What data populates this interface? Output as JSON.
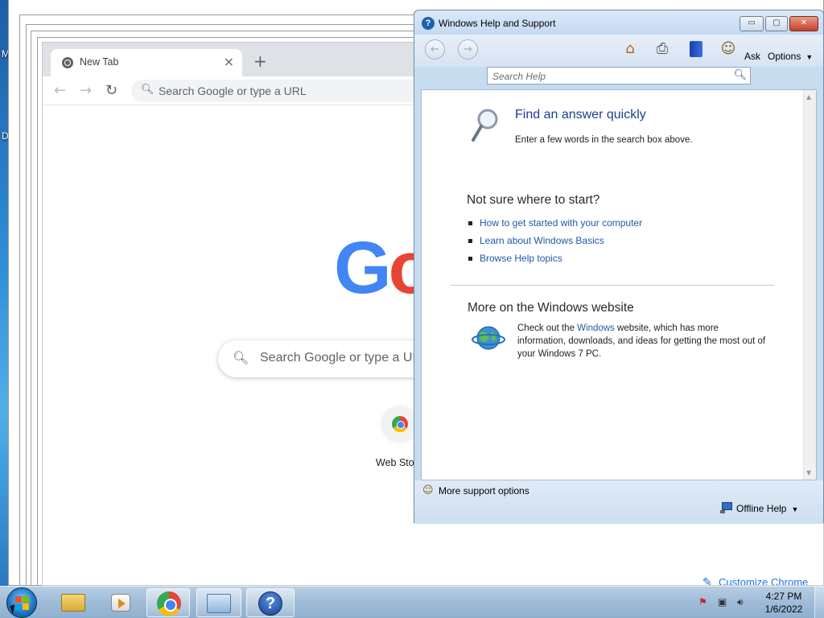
{
  "desktop": {
    "edge_letters": [
      "M",
      "D"
    ]
  },
  "chrome": {
    "tab_title": "New Tab",
    "tab_close": "×",
    "new_tab": "+",
    "back": "←",
    "forward": "→",
    "reload": "↻",
    "omnibox_placeholder": "Search Google or type a URL",
    "search_placeholder": "Search Google or type a URL",
    "shortcut_label": "Web Store",
    "customize_label": "Customize Chrome",
    "logo_letters": [
      "G",
      "o"
    ],
    "colors": {
      "blue": "#4285f4",
      "red": "#ea4335",
      "link": "#1a73e8"
    }
  },
  "help_window": {
    "title": "Windows Help and Support",
    "title_icon": "?",
    "buttons": {
      "minimize": "▭",
      "maximize": "▢",
      "close": "✕"
    },
    "toolbar": {
      "ask_label": "Ask",
      "options_label": "Options",
      "icons": [
        "back-icon",
        "forward-icon",
        "home-icon",
        "print-icon",
        "browse-help-icon",
        "ask-icon"
      ]
    },
    "search_placeholder": "Search Help",
    "find": {
      "title": "Find an answer quickly",
      "subtitle": "Enter a few words in the search box above."
    },
    "start": {
      "title": "Not sure where to start?",
      "links": [
        "How to get started with your computer",
        "Learn about Windows Basics",
        "Browse Help topics"
      ]
    },
    "more": {
      "title": "More on the Windows website",
      "text_before": "Check out the ",
      "link": "Windows",
      "text_after": " website, which has more information, downloads, and ideas for getting the most out of your Windows 7 PC."
    },
    "footer": {
      "support_label": "More support options",
      "offline_label": "Offline Help"
    }
  },
  "taskbar": {
    "items": [
      "windows-explorer",
      "media-center",
      "google-chrome",
      "control-panel",
      "help-and-support"
    ],
    "clock_time": "4:27 PM",
    "clock_date": "1/6/2022"
  }
}
